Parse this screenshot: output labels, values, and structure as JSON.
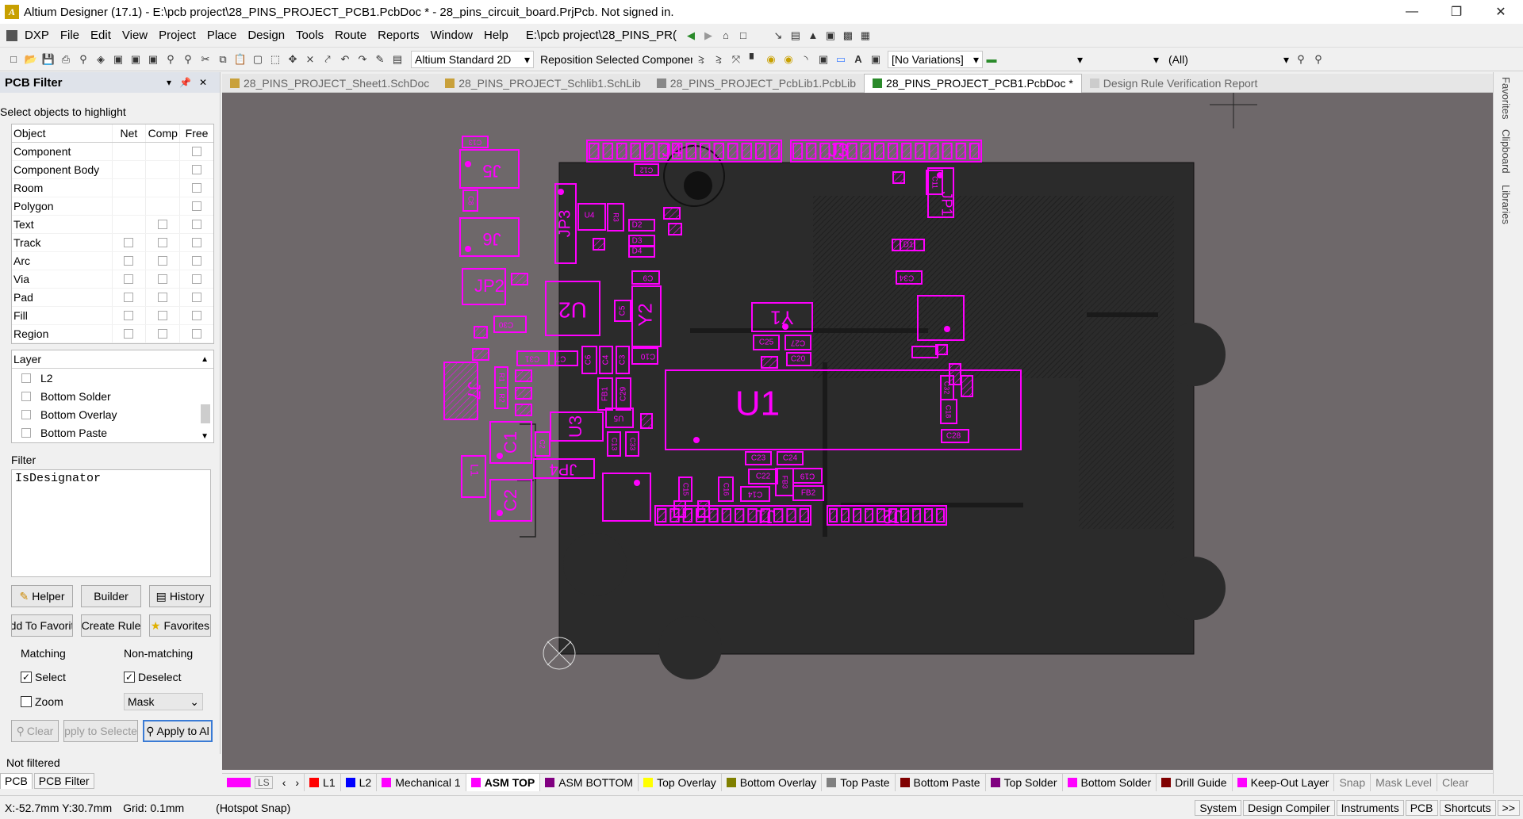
{
  "window": {
    "title": "Altium Designer (17.1) - E:\\pcb project\\28_PINS_PROJECT_PCB1.PcbDoc * - 28_pins_circuit_board.PrjPcb. Not signed in."
  },
  "menu": {
    "items": [
      "DXP",
      "File",
      "Edit",
      "View",
      "Project",
      "Place",
      "Design",
      "Tools",
      "Route",
      "Reports",
      "Window",
      "Help"
    ],
    "path_field": "E:\\pcb project\\28_PINS_PR("
  },
  "toolbar2": {
    "view_mode": "Altium Standard 2D",
    "reposition": "Reposition Selected Components",
    "variations": "[No Variations]",
    "filter_all": "(All)"
  },
  "panel": {
    "title": "PCB Filter",
    "select_objects_label": "Select objects to highlight",
    "columns": [
      "Object",
      "Net",
      "Comp",
      "Free"
    ],
    "objects": [
      {
        "name": "Component",
        "net": false,
        "comp": false,
        "free": true
      },
      {
        "name": "Component Body",
        "net": false,
        "comp": false,
        "free": true
      },
      {
        "name": "Room",
        "net": false,
        "comp": false,
        "free": true
      },
      {
        "name": "Polygon",
        "net": false,
        "comp": false,
        "free": true
      },
      {
        "name": "Text",
        "net": false,
        "comp": true,
        "free": true
      },
      {
        "name": "Track",
        "net": true,
        "comp": true,
        "free": true
      },
      {
        "name": "Arc",
        "net": true,
        "comp": true,
        "free": true
      },
      {
        "name": "Via",
        "net": true,
        "comp": true,
        "free": true
      },
      {
        "name": "Pad",
        "net": true,
        "comp": true,
        "free": true
      },
      {
        "name": "Fill",
        "net": true,
        "comp": true,
        "free": true
      },
      {
        "name": "Region",
        "net": true,
        "comp": true,
        "free": true
      }
    ],
    "layer_header": "Layer",
    "layers": [
      "L2",
      "Bottom Solder",
      "Bottom Overlay",
      "Bottom Paste"
    ],
    "filter_label": "Filter",
    "filter_text": "IsDesignator",
    "buttons": {
      "helper": "Helper",
      "builder": "Builder",
      "history": "History",
      "add_favorites": "dd To Favorit",
      "create_rule": "Create Rule",
      "favorites": "Favorites",
      "clear": "Clear",
      "apply_selected": "pply to Selecte",
      "apply_all": "Apply to Al"
    },
    "matching_label": "Matching",
    "non_matching_label": "Non-matching",
    "select_label": "Select",
    "deselect_label": "Deselect",
    "zoom_label": "Zoom",
    "mask_value": "Mask",
    "status": "Not filtered",
    "bottom_tabs": [
      "PCB",
      "PCB Filter"
    ]
  },
  "doc_tabs": [
    {
      "label": "28_PINS_PROJECT_Sheet1.SchDoc",
      "active": false
    },
    {
      "label": "28_PINS_PROJECT_Schlib1.SchLib",
      "active": false
    },
    {
      "label": "28_PINS_PROJECT_PcbLib1.PcbLib",
      "active": false
    },
    {
      "label": "28_PINS_PROJECT_PCB1.PcbDoc *",
      "active": true
    },
    {
      "label": "Design Rule Verification Report",
      "active": false
    }
  ],
  "right_tabs": [
    "Favorites",
    "Clipboard",
    "Libraries"
  ],
  "pcb": {
    "designators": [
      "J3",
      "J4",
      "J5",
      "J6",
      "JP1",
      "JP2",
      "JP3",
      "JP4",
      "J1",
      "J2",
      "J7",
      "U1",
      "U2",
      "U3",
      "U4",
      "U5",
      "Y1",
      "Y2",
      "C1",
      "C2",
      "C3",
      "C4",
      "C5",
      "C6",
      "C7",
      "C8",
      "C9",
      "C10",
      "C11",
      "C12",
      "C13",
      "C14",
      "C15",
      "C16",
      "C17",
      "C18",
      "C19",
      "C20",
      "C21",
      "C22",
      "C23",
      "C24",
      "C25",
      "C26",
      "C27",
      "C28",
      "C29",
      "C30",
      "C31",
      "C32",
      "C33",
      "C34",
      "D1",
      "D2",
      "D3",
      "D4",
      "L1",
      "FB1",
      "FB2",
      "FB3",
      "R1",
      "R2",
      "R3"
    ],
    "magenta": "#ff00ff",
    "board_color": "#2b2b2b"
  },
  "layer_tabs": [
    {
      "name": "LS",
      "color": "#ff00ff"
    },
    {
      "name": "L1",
      "color": "#ff0000"
    },
    {
      "name": "L2",
      "color": "#0000ff"
    },
    {
      "name": "Mechanical 1",
      "color": "#ff00ff"
    },
    {
      "name": "ASM TOP",
      "color": "#ff00ff"
    },
    {
      "name": "ASM BOTTOM",
      "color": "#800080"
    },
    {
      "name": "Top Overlay",
      "color": "#ffff00"
    },
    {
      "name": "Bottom Overlay",
      "color": "#808000"
    },
    {
      "name": "Top Paste",
      "color": "#808080"
    },
    {
      "name": "Bottom Paste",
      "color": "#800000"
    },
    {
      "name": "Top Solder",
      "color": "#800080"
    },
    {
      "name": "Bottom Solder",
      "color": "#ff00ff"
    },
    {
      "name": "Drill Guide",
      "color": "#800000"
    },
    {
      "name": "Keep-Out Layer",
      "color": "#ff00ff"
    }
  ],
  "layer_tab_extras": [
    "Snap",
    "Mask Level",
    "Clear"
  ],
  "status": {
    "coords": "X:-52.7mm Y:30.7mm",
    "grid": "Grid: 0.1mm",
    "snap": "(Hotspot Snap)",
    "buttons": [
      "System",
      "Design Compiler",
      "Instruments",
      "PCB",
      "Shortcuts",
      ">>"
    ]
  }
}
